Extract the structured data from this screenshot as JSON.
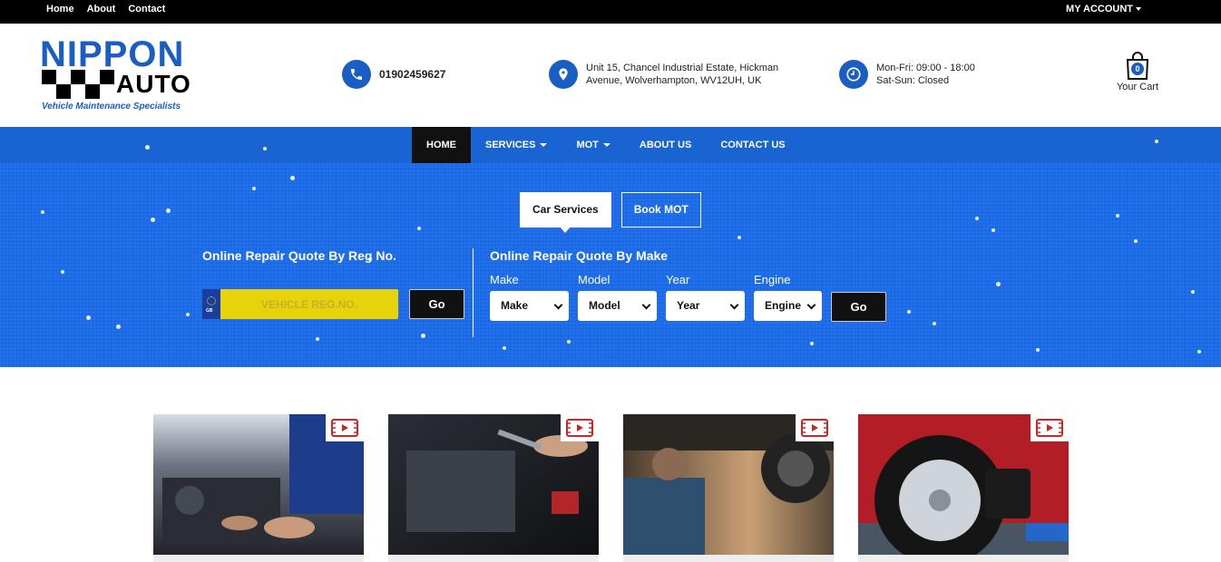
{
  "topbar": {
    "links": [
      "Home",
      "About",
      "Contact"
    ],
    "account_label": "MY ACCOUNT"
  },
  "header": {
    "logo": {
      "line1": "NIPPON",
      "line2": "AUTO",
      "tagline": "Vehicle Maintenance Specialists"
    },
    "phone": "01902459627",
    "address_line1": "Unit 15, Chancel Industrial Estate, Hickman",
    "address_line2": "Avenue, Wolverhampton, WV12UH, UK",
    "hours_line1": "Mon-Fri: 09:00 - 18:00",
    "hours_line2": "Sat-Sun: Closed",
    "cart_label": "Your Cart",
    "cart_count": "0"
  },
  "nav": {
    "items": [
      "HOME",
      "SERVICES",
      "MOT",
      "ABOUT US",
      "CONTACT US"
    ]
  },
  "hero": {
    "tabs": [
      "Car Services",
      "Book MOT"
    ],
    "reg_title": "Online Repair Quote By Reg No.",
    "reg_placeholder": "VEHICLE REG.NO.",
    "plate_country": "GB",
    "go_label": "Go",
    "make_title": "Online Repair Quote By Make",
    "fields": [
      {
        "label": "Make",
        "value": "Make"
      },
      {
        "label": "Model",
        "value": "Model"
      },
      {
        "label": "Year",
        "value": "Year"
      },
      {
        "label": "Engine",
        "value": "Engine"
      }
    ]
  },
  "colors": {
    "brand_blue": "#1a5dc4",
    "hero_blue": "#1a6ae8",
    "plate_yellow": "#e8d20a"
  }
}
